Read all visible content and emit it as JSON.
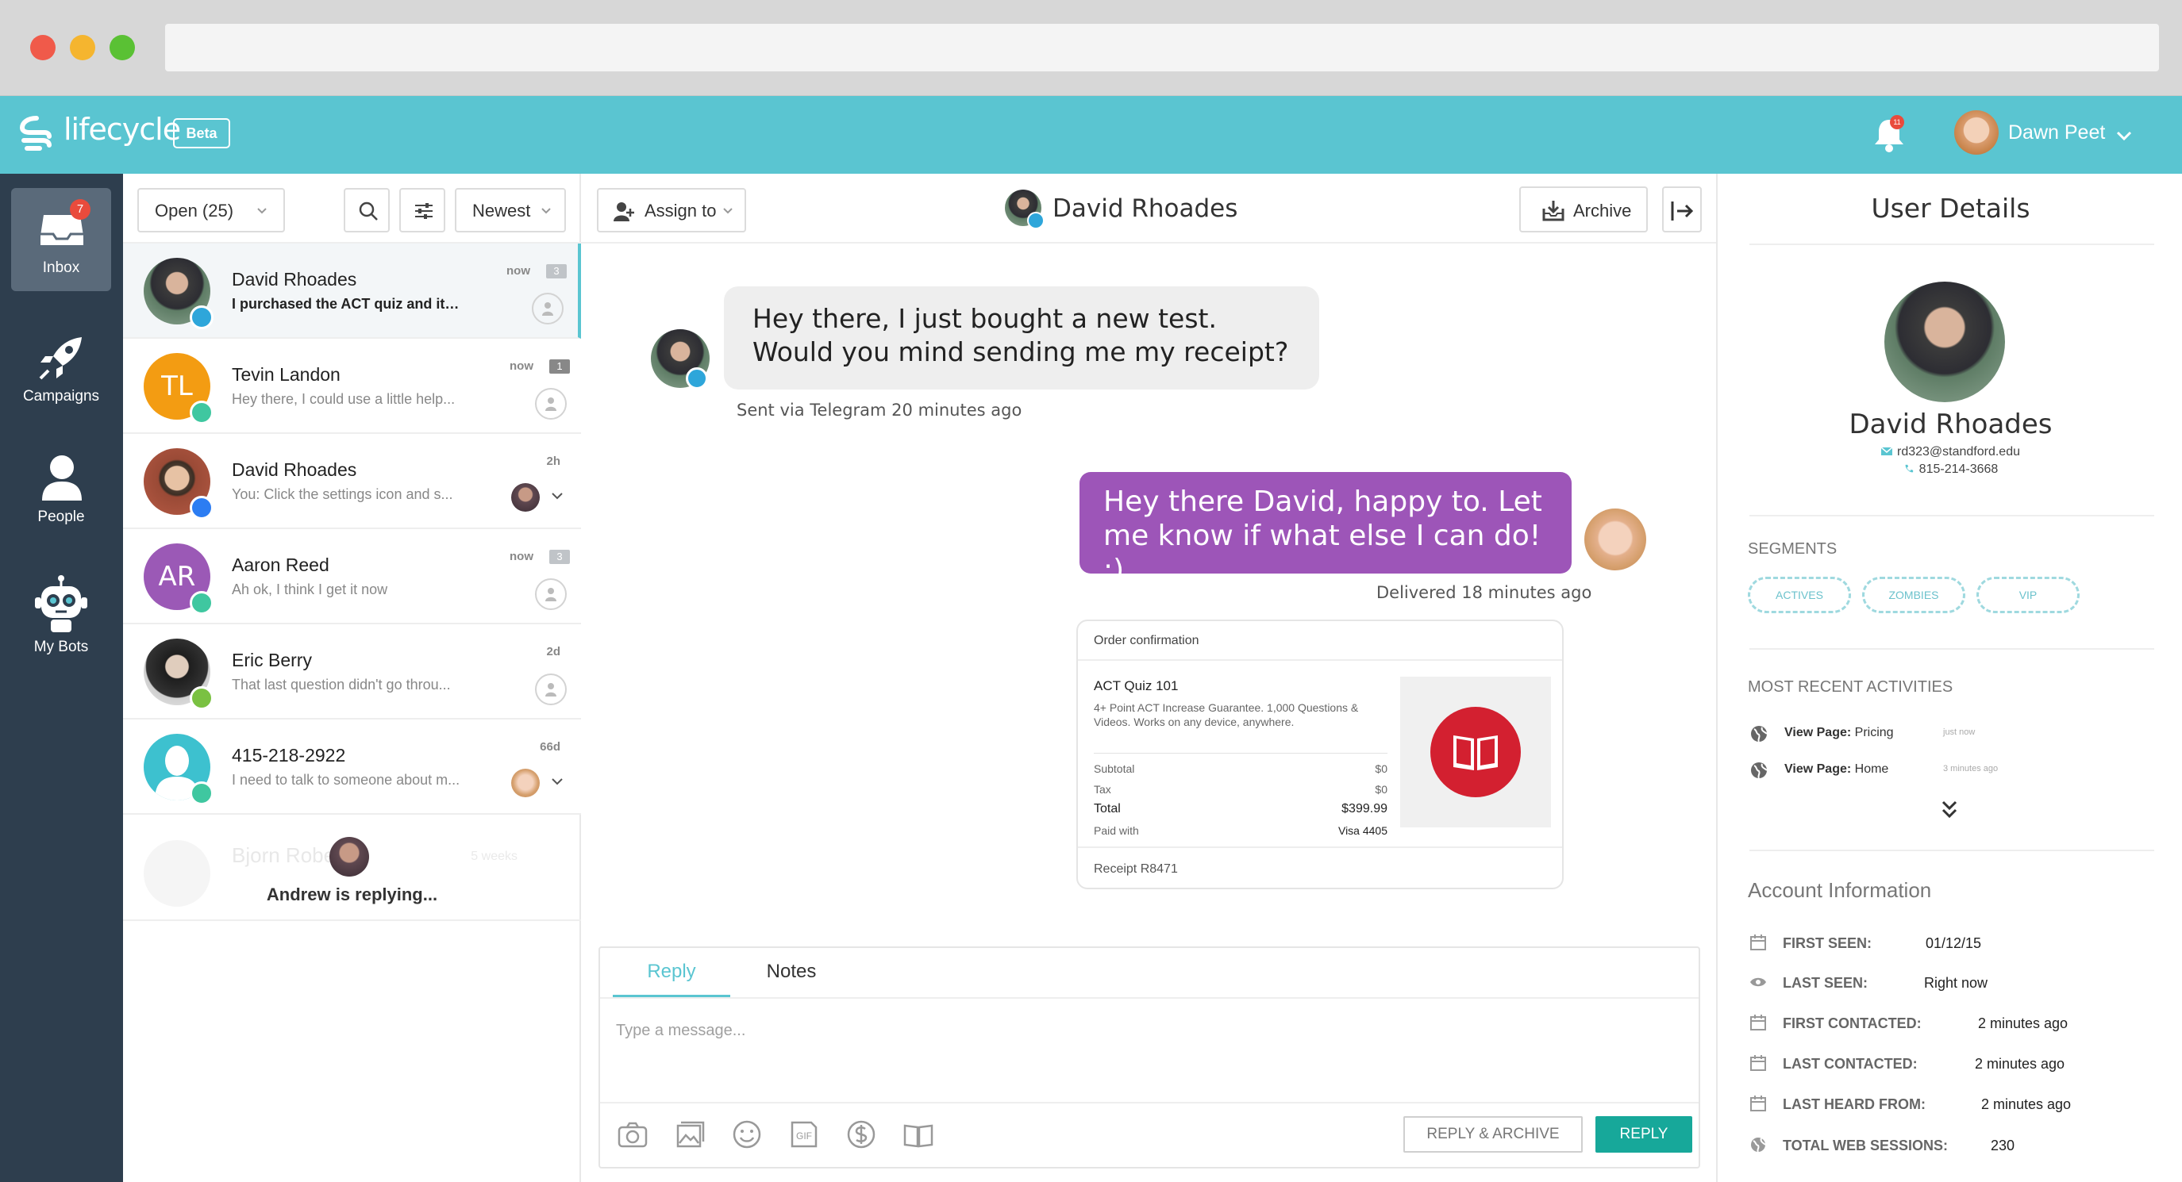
{
  "app": {
    "brand": "lifecycle",
    "beta_label": "Beta",
    "notification_count": "11",
    "user_name": "Dawn Peet",
    "accent_color": "#5ac5d1",
    "nav_color": "#2e3e4e"
  },
  "nav": {
    "inbox_label": "Inbox",
    "inbox_badge": "7",
    "campaigns_label": "Campaigns",
    "people_label": "People",
    "bots_label": "My Bots"
  },
  "list": {
    "filter_label": "Open (25)",
    "sort_label": "Newest",
    "conversations": [
      {
        "name": "David Rhoades",
        "preview": "I purchased the ACT quiz and it's...",
        "time": "now",
        "count": "3",
        "channel": "telegram"
      },
      {
        "name": "Tevin Landon",
        "initials": "TL",
        "preview": "Hey there, I could use a little help...",
        "time": "now",
        "count": "1",
        "channel": "chat"
      },
      {
        "name": "David Rhoades",
        "preview": "You: Click the settings icon and s...",
        "time": "2h",
        "channel": "messenger"
      },
      {
        "name": "Aaron Reed",
        "initials": "AR",
        "preview": "Ah ok, I think I get it now",
        "time": "now",
        "count": "3",
        "channel": "chat"
      },
      {
        "name": "Eric Berry",
        "preview": "That last question didn't go throu...",
        "time": "2d",
        "channel": "kik"
      },
      {
        "name": "415-218-2922",
        "preview": "I need to talk to someone about m...",
        "time": "66d",
        "channel": "chat"
      }
    ],
    "replying": {
      "ghost_name": "Bjorn Roberts",
      "ghost_time": "5 weeks",
      "text": "Andrew is replying..."
    }
  },
  "conversation": {
    "assign_label": "Assign to",
    "title": "David Rhoades",
    "archive_label": "Archive",
    "incoming_text": "Hey there, I just bought a new test. Would you mind sending me my receipt?",
    "incoming_meta": "Sent via Telegram 20 minutes ago",
    "outgoing_text": "Hey there David, happy to. Let me know if what else I can do!  :)",
    "outgoing_meta": "Delivered 18 minutes ago",
    "receipt": {
      "title": "Order confirmation",
      "product": "ACT Quiz 101",
      "description": "4+ Point ACT Increase Guarantee. 1,000 Questions & Videos. Works on any device, anywhere.",
      "rows": [
        {
          "label": "Subtotal",
          "value": "$0"
        },
        {
          "label": "Tax",
          "value": "$0"
        },
        {
          "label": "Total",
          "value": "$399.99"
        },
        {
          "label": "Paid with",
          "value": "Visa 4405"
        }
      ],
      "receipt_no": "Receipt R8471"
    },
    "composer": {
      "tab_reply": "Reply",
      "tab_notes": "Notes",
      "placeholder": "Type a message...",
      "reply_archive_label": "REPLY & ARCHIVE",
      "reply_label": "REPLY",
      "gif_label": "GIF"
    }
  },
  "details": {
    "title": "User Details",
    "name": "David Rhoades",
    "email": "rd323@standford.edu",
    "phone": "815-214-3668",
    "segments_heading": "SEGMENTS",
    "segments": [
      "ACTIVES",
      "ZOMBIES",
      "VIP"
    ],
    "activities_heading": "MOST RECENT ACTIVITIES",
    "activities": [
      {
        "label": "View Page:",
        "page": "Pricing",
        "time": "just now"
      },
      {
        "label": "View Page:",
        "page": "Home",
        "time": "3 minutes ago"
      }
    ],
    "account_heading": "Account Information",
    "account": [
      {
        "key": "FIRST SEEN:",
        "value": "01/12/15"
      },
      {
        "key": "LAST SEEN:",
        "value": "Right now"
      },
      {
        "key": "FIRST CONTACTED:",
        "value": "2 minutes ago"
      },
      {
        "key": "LAST CONTACTED:",
        "value": "2 minutes ago"
      },
      {
        "key": "LAST HEARD FROM:",
        "value": "2 minutes ago"
      },
      {
        "key": "TOTAL WEB SESSIONS:",
        "value": "230"
      }
    ]
  }
}
